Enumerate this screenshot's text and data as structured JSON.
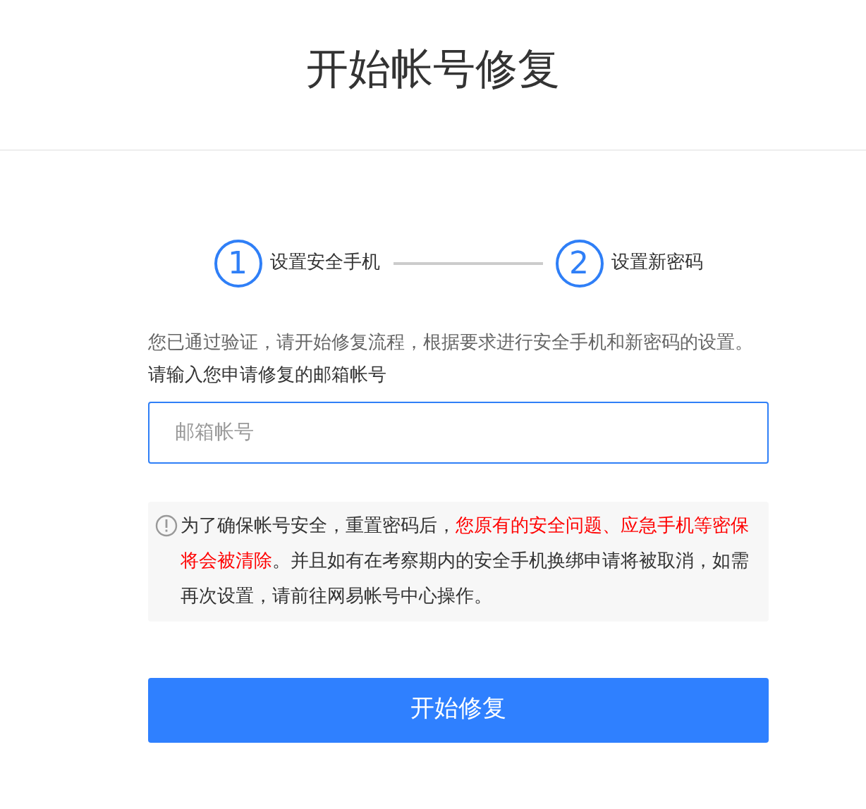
{
  "header": {
    "title": "开始帐号修复"
  },
  "steps": [
    {
      "number": "1",
      "label": "设置安全手机"
    },
    {
      "number": "2",
      "label": "设置新密码"
    }
  ],
  "intro": "您已通过验证，请开始修复流程，根据要求进行安全手机和新密码的设置。",
  "email_field": {
    "label": "请输入您申请修复的邮箱帐号",
    "placeholder": "邮箱帐号"
  },
  "notice": {
    "segments": [
      {
        "text": "为了确保帐号安全，重置密码后，",
        "kind": "normal"
      },
      {
        "text": "您原有的安全问题、应急手机等密保将会被清除",
        "kind": "warning"
      },
      {
        "text": "。并且如有在考察期内的安全手机换绑申请将被取消，如需再次设置，请前往网易帐号中心操作。",
        "kind": "normal"
      }
    ]
  },
  "submit_button": "开始修复"
}
